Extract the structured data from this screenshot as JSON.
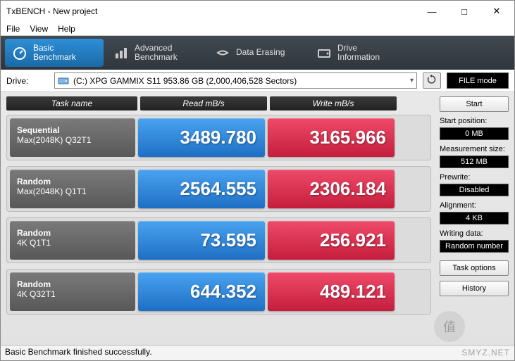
{
  "window": {
    "title": "TxBENCH - New project"
  },
  "menu": {
    "file": "File",
    "view": "View",
    "help": "Help"
  },
  "toolbar": {
    "basic": "Basic\nBenchmark",
    "advanced": "Advanced\nBenchmark",
    "erasing": "Data Erasing",
    "driveinfo": "Drive\nInformation"
  },
  "drive": {
    "label": "Drive:",
    "selected": "(C:) XPG GAMMIX S11  953.86 GB (2,000,406,528 Sectors)",
    "file_mode": "FILE mode"
  },
  "headers": {
    "task": "Task name",
    "read": "Read mB/s",
    "write": "Write mB/s"
  },
  "rows": [
    {
      "name1": "Sequential",
      "name2": "Max(2048K) Q32T1",
      "read": "3489.780",
      "write": "3165.966"
    },
    {
      "name1": "Random",
      "name2": "Max(2048K) Q1T1",
      "read": "2564.555",
      "write": "2306.184"
    },
    {
      "name1": "Random",
      "name2": "4K Q1T1",
      "read": "73.595",
      "write": "256.921"
    },
    {
      "name1": "Random",
      "name2": "4K Q32T1",
      "read": "644.352",
      "write": "489.121"
    }
  ],
  "side": {
    "start": "Start",
    "start_pos_lbl": "Start position:",
    "start_pos_val": "0 MB",
    "meas_lbl": "Measurement size:",
    "meas_val": "512 MB",
    "prewrite_lbl": "Prewrite:",
    "prewrite_val": "Disabled",
    "align_lbl": "Alignment:",
    "align_val": "4 KB",
    "writing_lbl": "Writing data:",
    "writing_val": "Random number",
    "task_opt": "Task options",
    "history": "History"
  },
  "status": "Basic Benchmark finished successfully.",
  "watermark": "SMYZ.NET",
  "watermark_logo": "值",
  "chart_data": {
    "type": "table",
    "title": "TxBENCH Basic Benchmark",
    "columns": [
      "Task name",
      "Read mB/s",
      "Write mB/s"
    ],
    "rows": [
      [
        "Sequential Max(2048K) Q32T1",
        3489.78,
        3165.966
      ],
      [
        "Random Max(2048K) Q1T1",
        2564.555,
        2306.184
      ],
      [
        "Random 4K Q1T1",
        73.595,
        256.921
      ],
      [
        "Random 4K Q32T1",
        644.352,
        489.121
      ]
    ]
  }
}
